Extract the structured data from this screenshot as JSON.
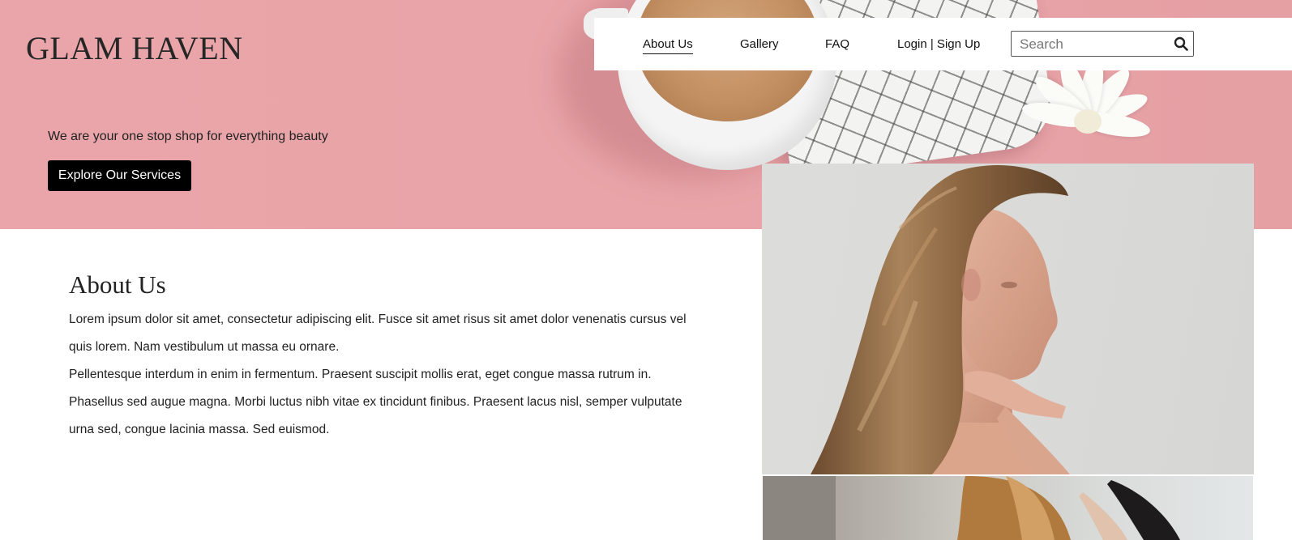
{
  "brand": {
    "logo": "GLAM HAVEN"
  },
  "nav": {
    "items": [
      {
        "label": "About Us",
        "active": true
      },
      {
        "label": "Gallery",
        "active": false
      },
      {
        "label": "FAQ",
        "active": false
      },
      {
        "label": "Login | Sign Up",
        "active": false
      }
    ],
    "search": {
      "placeholder": "Search",
      "value": "",
      "icon": "search-icon"
    }
  },
  "hero": {
    "tagline": "We are your one stop shop for everything beauty",
    "cta_label": "Explore Our Services",
    "background_color": "#e8a4a8"
  },
  "about": {
    "title": "About Us",
    "paragraphs": [
      "Lorem ipsum dolor sit amet, consectetur adipiscing elit. Fusce sit amet risus sit amet dolor venenatis cursus vel quis lorem. Nam vestibulum ut massa eu ornare.",
      "Pellentesque interdum in enim in fermentum. Praesent suscipit mollis erat, eget congue massa rutrum in. Phasellus sed augue magna. Morbi luctus nibh vitae ex tincidunt finibus. Praesent lacus nisl, semper vulputate urna sed, congue lacinia massa. Sed euismod."
    ]
  },
  "colors": {
    "accent": "#000000",
    "text": "#222222",
    "hero_pink": "#e8a4a8"
  }
}
